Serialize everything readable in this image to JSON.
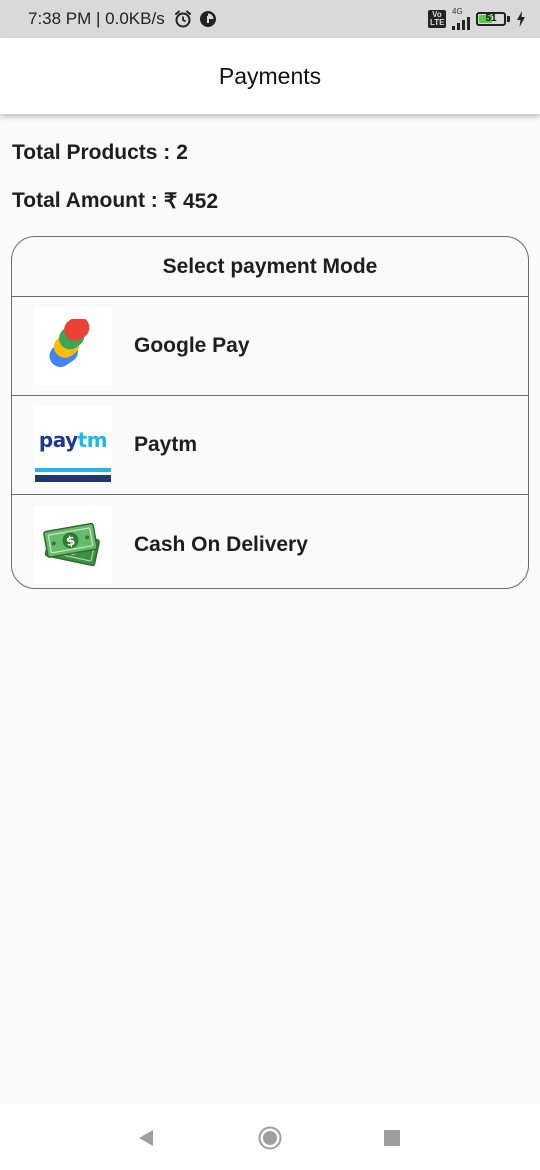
{
  "status_bar": {
    "time_speed": "7:38 PM | 0.0KB/s",
    "volte_label": "Vo\nLTE",
    "network_type": "4G",
    "battery_level": "51"
  },
  "app_bar": {
    "title": "Payments"
  },
  "summary": {
    "products_label": "Total Products :",
    "products_value": "2",
    "amount_label": "Total Amount :",
    "amount_value": "₹ 452"
  },
  "payment": {
    "header": "Select payment Mode",
    "options": [
      {
        "label": "Google Pay",
        "icon": "google-pay-logo"
      },
      {
        "label": "Paytm",
        "icon": "paytm-logo",
        "logo_text_pay": "pay",
        "logo_text_tm": "tm"
      },
      {
        "label": "Cash On Delivery",
        "icon": "cash-icon"
      }
    ]
  },
  "colors": {
    "background": "#fafafa",
    "app_bar": "#ffffff",
    "status_bar": "#d9d9d9",
    "card_border": "#6b6b6b",
    "paytm_navy": "#1f3a8a",
    "paytm_cyan": "#1fb8e8",
    "cash_green": "#4caf50"
  },
  "nav_bar": {
    "back_icon": "back-triangle-icon",
    "home_icon": "home-circle-icon",
    "recent_icon": "recent-square-icon"
  }
}
